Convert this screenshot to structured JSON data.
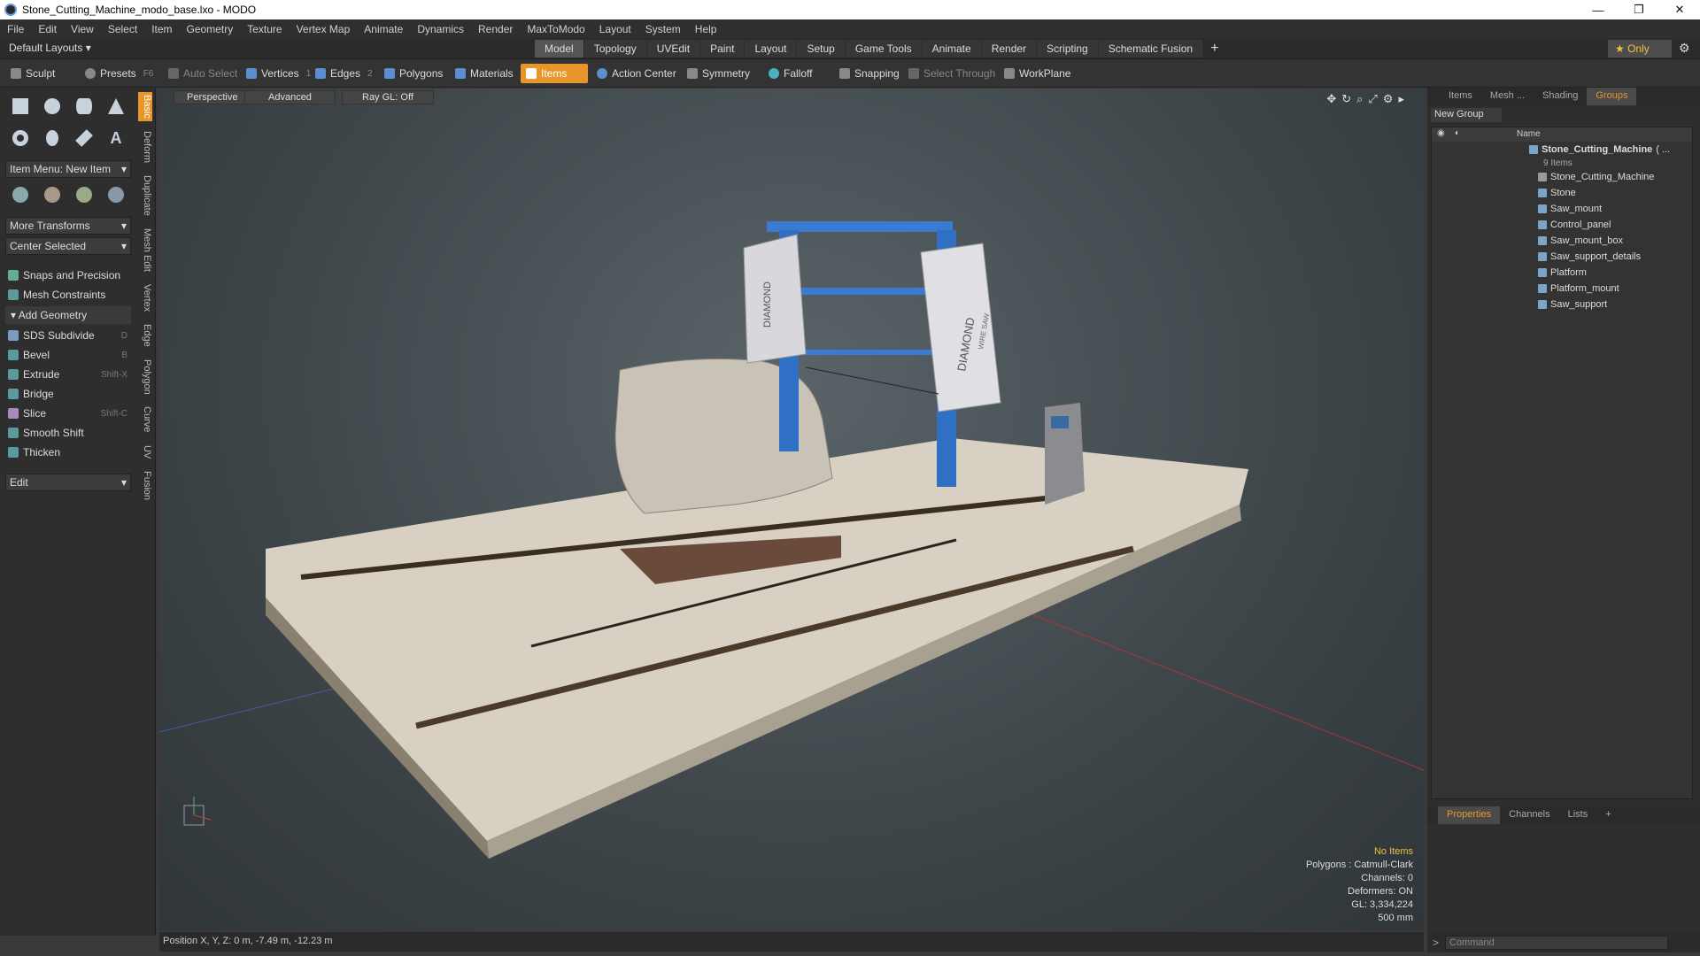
{
  "window": {
    "title": "Stone_Cutting_Machine_modo_base.lxo - MODO",
    "min": "—",
    "max": "❐",
    "close": "✕"
  },
  "menu": [
    "File",
    "Edit",
    "View",
    "Select",
    "Item",
    "Geometry",
    "Texture",
    "Vertex Map",
    "Animate",
    "Dynamics",
    "Render",
    "MaxToModo",
    "Layout",
    "System",
    "Help"
  ],
  "layouts": {
    "label": "Default Layouts ▾",
    "tabs": [
      "Model",
      "Topology",
      "UVEdit",
      "Paint",
      "Layout",
      "Setup",
      "Game Tools",
      "Animate",
      "Render",
      "Scripting",
      "Schematic Fusion"
    ],
    "active": "Model",
    "plus": "+",
    "only": "★  Only"
  },
  "toolbar": {
    "sculpt": "Sculpt",
    "presets": "Presets",
    "presets_key": "F6",
    "auto_select": "Auto Select",
    "vertices": "Vertices",
    "vertices_n": "1",
    "edges": "Edges",
    "edges_n": "2",
    "polygons": "Polygons",
    "materials": "Materials",
    "items": "Items",
    "action_center": "Action Center",
    "symmetry": "Symmetry",
    "falloff": "Falloff",
    "snapping": "Snapping",
    "select_through": "Select Through",
    "workplane": "WorkPlane"
  },
  "left": {
    "item_menu": "Item Menu: New Item",
    "more_transforms": "More Transforms",
    "center_selected": "Center Selected",
    "snaps": "Snaps and Precision",
    "mesh_constraints": "Mesh Constraints",
    "add_geometry": "Add Geometry",
    "tools": [
      {
        "label": "SDS Subdivide",
        "key": "D"
      },
      {
        "label": "Bevel",
        "key": "B"
      },
      {
        "label": "Extrude",
        "key": "Shift-X"
      },
      {
        "label": "Bridge",
        "key": ""
      },
      {
        "label": "Slice",
        "key": "Shift-C"
      },
      {
        "label": "Smooth Shift",
        "key": ""
      },
      {
        "label": "Thicken",
        "key": ""
      }
    ],
    "edit": "Edit",
    "vtabs": [
      "Basic",
      "Deform",
      "Duplicate",
      "Mesh Edit",
      "Vertex",
      "Edge",
      "Polygon",
      "Curve",
      "UV",
      "Fusion"
    ]
  },
  "viewport": {
    "perspective": "Perspective",
    "advanced": "Advanced",
    "raygl": "Ray GL: Off",
    "info": {
      "no_items": "No Items",
      "polygons": "Polygons : Catmull-Clark",
      "channels": "Channels: 0",
      "deformers": "Deformers: ON",
      "gl": "GL: 3,334,224",
      "scale": "500 mm"
    },
    "labels": {
      "diamond": "DIAMOND",
      "wire_saw": "WIRE SAW"
    }
  },
  "status": {
    "position": "Position X, Y, Z:  0 m, -7.49 m, -12.23 m"
  },
  "right": {
    "tabs": [
      "Items",
      "Mesh ...",
      "Shading",
      "Groups"
    ],
    "active_tab": "Groups",
    "new_group": "New Group",
    "name_header": "Name",
    "root": "Stone_Cutting_Machine",
    "root_suffix": "( ...",
    "count": "9 Items",
    "children": [
      "Stone_Cutting_Machine",
      "Stone",
      "Saw_mount",
      "Control_panel",
      "Saw_mount_box",
      "Saw_support_details",
      "Platform",
      "Platform_mount",
      "Saw_support"
    ],
    "bottom_tabs": [
      "Properties",
      "Channels",
      "Lists",
      "+"
    ],
    "command": "Command"
  }
}
